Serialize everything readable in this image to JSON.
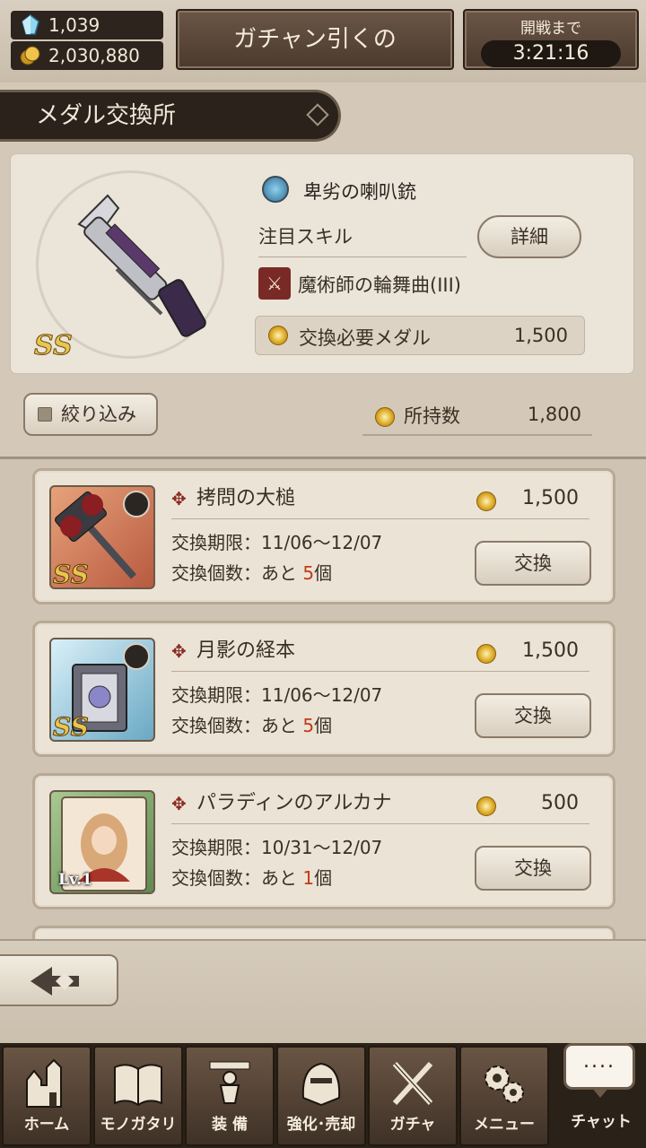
{
  "header": {
    "gems": "1,039",
    "coins": "2,030,880",
    "gacha_button": "ガチャン引くの",
    "open_label": "開戦まで",
    "open_timer": "3:21:16"
  },
  "page_title": "メダル交換所",
  "selected": {
    "name": "卑劣の喇叭銃",
    "rarity": "SS",
    "skill_label": "注目スキル",
    "detail_button": "詳細",
    "skill_name": "魔術師の輪舞曲(III)",
    "required_label": "交換必要メダル",
    "required_value": "1,500"
  },
  "filter_button": "絞り込み",
  "owned_label": "所持数",
  "owned_value": "1,800",
  "items": [
    {
      "name": "拷問の大槌",
      "price": "1,500",
      "period_label": "交換期限：",
      "period": "11/06〜12/07",
      "count_label": "交換個数：あと",
      "count": "5",
      "count_unit": "個",
      "button": "交換",
      "badge": "SS"
    },
    {
      "name": "月影の経本",
      "price": "1,500",
      "period_label": "交換期限：",
      "period": "11/06〜12/07",
      "count_label": "交換個数：あと",
      "count": "5",
      "count_unit": "個",
      "button": "交換",
      "badge": "SS"
    },
    {
      "name": "パラディンのアルカナ",
      "price": "500",
      "period_label": "交換期限：",
      "period": "10/31〜12/07",
      "count_label": "交換個数：あと",
      "count": "1",
      "count_unit": "個",
      "button": "交換",
      "badge": "Lv.1"
    }
  ],
  "nav": {
    "home": "ホーム",
    "story": "モノガタリ",
    "equip": "装 備",
    "enhance": "強化･売却",
    "gacha": "ガチャ",
    "menu": "メニュー",
    "chat": "チャット",
    "chat_dots": "...."
  },
  "icons": {
    "gem": "crystal-icon",
    "coin": "gold-coin-icon",
    "medal": "medal-icon",
    "water": "water-element-icon",
    "skill": "crossed-swords-icon",
    "back": "back-arrow-icon"
  },
  "colors": {
    "accent_red": "#c23a16",
    "dark_brown": "#2a2119",
    "gold": "#e7c650"
  }
}
